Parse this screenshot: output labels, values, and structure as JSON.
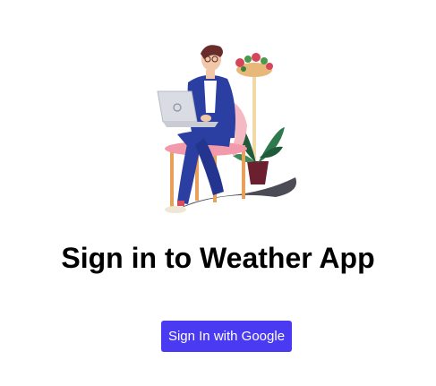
{
  "page": {
    "title": "Sign in to Weather App"
  },
  "auth": {
    "google_button_label": "Sign In with Google"
  },
  "illustration": {
    "icon": "person-with-laptop-illustration"
  },
  "colors": {
    "button_bg": "#4a3bf2",
    "button_text": "#ffffff",
    "title_text": "#000000",
    "background": "#ffffff"
  }
}
